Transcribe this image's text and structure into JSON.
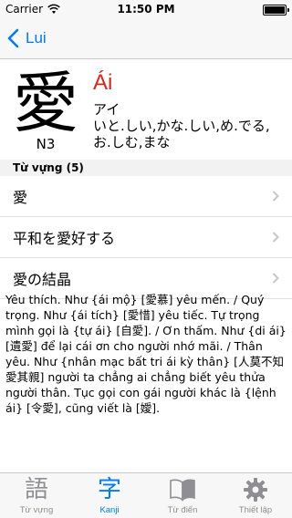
{
  "status": {
    "carrier": "Carrier",
    "time": "11:50 PM",
    "battery_level": 1.0
  },
  "nav": {
    "back_label": "Lui"
  },
  "kanji": {
    "character": "愛",
    "level": "N3",
    "hanviet": "Ái",
    "reading_line1": "アイ",
    "reading_line2": "いと.しい,かな.しい,め.でる,お.しむ,まな"
  },
  "vocab_section": {
    "title": "Từ vựng (5)",
    "items": [
      {
        "text": "愛"
      },
      {
        "text": "平和を愛好する"
      },
      {
        "text": "愛の結晶"
      }
    ]
  },
  "meaning": "Yêu thích. Như {ái mộ} [愛慕] yêu mến. / Quý trọng. Như {ái tích} [愛惜] yêu tiếc. Tự trọng mình gọi là {tự ái} [自愛]. / Ơn thấm. Như {di ái} [遺愛] để lại cái ơn cho người nhớ mãi. / Thân yêu. Như {nhân mạc bất tri ái kỳ thân} [人莫不知愛其親] người ta chẳng ai chẳng biết yêu thửa người thân. Tục gọi con gái người khác là {lệnh ái} [令愛], cũng viết là [嬡].",
  "tabs": [
    {
      "label": "Từ vựng",
      "glyph": "語",
      "icon": "vocabulary-icon"
    },
    {
      "label": "Kanji",
      "glyph": "字",
      "icon": "kanji-icon",
      "active": true
    },
    {
      "label": "Từ điển",
      "glyph": "",
      "icon": "book-icon"
    },
    {
      "label": "Thiết lập",
      "glyph": "",
      "icon": "gear-icon"
    }
  ],
  "colors": {
    "accent": "#007aff",
    "hanviet": "#e8201a",
    "inactive": "#8e8e93"
  }
}
